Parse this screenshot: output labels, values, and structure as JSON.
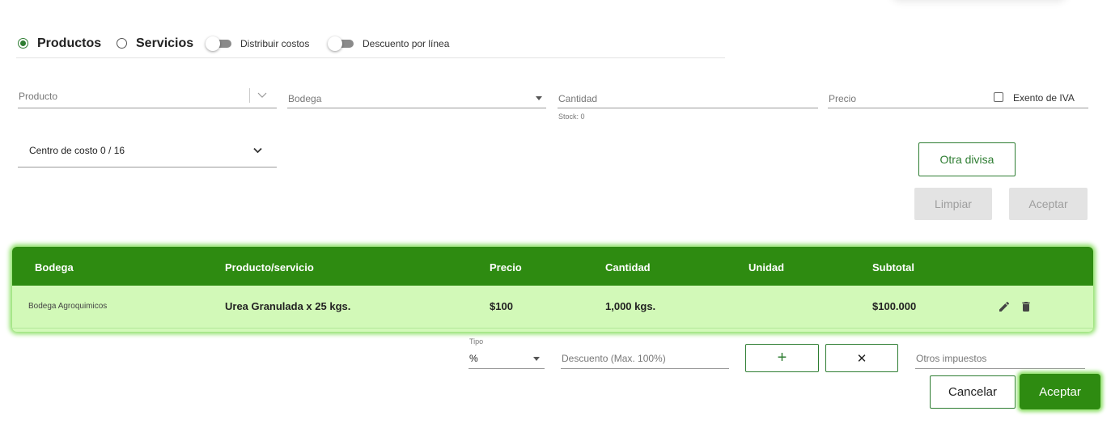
{
  "type_selector": {
    "productos_label": "Productos",
    "servicios_label": "Servicios",
    "distribuir_costos_label": "Distribuir costos",
    "descuento_linea_label": "Descuento por línea"
  },
  "form": {
    "producto_placeholder": "Producto",
    "bodega_placeholder": "Bodega",
    "cantidad_placeholder": "Cantidad",
    "stock_text": "Stock: 0",
    "precio_placeholder": "Precio",
    "exento_iva_label": "Exento de IVA",
    "centro_costo_value": "Centro de costo 0 / 16"
  },
  "actions": {
    "otra_divisa_label": "Otra divisa",
    "limpiar_label": "Limpiar",
    "aceptar_label": "Aceptar"
  },
  "table": {
    "columns": [
      "Bodega",
      "Producto/servicio",
      "Precio",
      "Cantidad",
      "Unidad",
      "Subtotal"
    ],
    "rows": [
      {
        "bodega": "Bodega Agroquimicos",
        "producto": "Urea Granulada x 25 kgs.",
        "precio": "$100",
        "cantidad": "1,000 kgs.",
        "unidad": "",
        "subtotal": "$100.000"
      }
    ]
  },
  "discount": {
    "tipo_label": "Tipo",
    "tipo_value": "%",
    "descuento_placeholder": "Descuento (Max. 100%)",
    "add_symbol": "+",
    "remove_symbol": "✕",
    "otros_impuestos_placeholder": "Otros impuestos"
  },
  "footer": {
    "cancelar_label": "Cancelar",
    "aceptar_label": "Aceptar"
  },
  "colors": {
    "primary_green": "#2e8b11",
    "row_highlight": "#d2f9b8",
    "glow": "#8ee068"
  }
}
